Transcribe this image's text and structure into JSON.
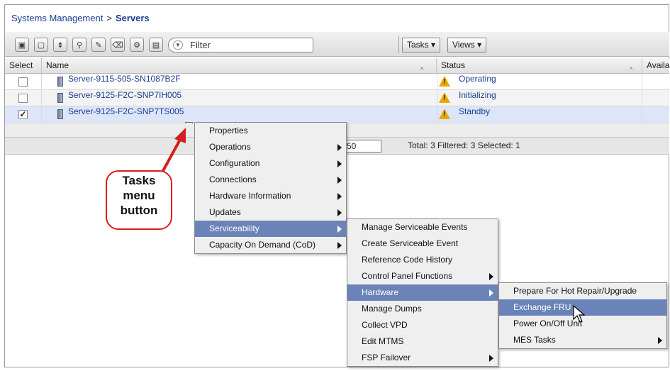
{
  "breadcrumb": {
    "parent": "Systems Management",
    "separator": ">",
    "current": "Servers"
  },
  "toolbar": {
    "filter_placeholder": "Filter",
    "tasks_label": "Tasks ▾",
    "views_label": "Views ▾",
    "icons": [
      "select-all-icon",
      "deselect-all-icon",
      "expand-icon",
      "filter-icon",
      "edit-icon",
      "clear-icon",
      "configure-columns-icon",
      "properties-icon"
    ]
  },
  "table": {
    "columns": {
      "select": "Select",
      "name": "Name",
      "status": "Status",
      "available": "Availal"
    },
    "sort_glyph": "^",
    "rows": [
      {
        "checked": false,
        "check_glyph": "",
        "name": "Server-9115-505-SN1087B2F",
        "status": "Operating"
      },
      {
        "checked": false,
        "check_glyph": "",
        "name": "Server-9125-F2C-SNP7IH005",
        "status": "Initializing"
      },
      {
        "checked": true,
        "check_glyph": "✓",
        "name": "Server-9125-F2C-SNP7TS005",
        "status": "Standby"
      }
    ],
    "warn_glyph": "!",
    "tasks_button_glyph": "»"
  },
  "pager": {
    "page_size": "50",
    "summary": "Total: 3   Filtered: 3   Selected: 1"
  },
  "menu1": [
    {
      "label": "Properties",
      "submenu": false
    },
    {
      "label": "Operations",
      "submenu": true
    },
    {
      "label": "Configuration",
      "submenu": true
    },
    {
      "label": "Connections",
      "submenu": true
    },
    {
      "label": "Hardware Information",
      "submenu": true
    },
    {
      "label": "Updates",
      "submenu": true
    },
    {
      "label": "Serviceability",
      "submenu": true
    },
    {
      "label": "Capacity On Demand (CoD)",
      "submenu": true
    }
  ],
  "menu2": [
    {
      "label": "Manage Serviceable Events",
      "submenu": false
    },
    {
      "label": "Create Serviceable Event",
      "submenu": false
    },
    {
      "label": "Reference Code History",
      "submenu": false
    },
    {
      "label": "Control Panel Functions",
      "submenu": true
    },
    {
      "label": "Hardware",
      "submenu": true
    },
    {
      "label": "Manage Dumps",
      "submenu": false
    },
    {
      "label": "Collect VPD",
      "submenu": false
    },
    {
      "label": "Edit MTMS",
      "submenu": false
    },
    {
      "label": "FSP Failover",
      "submenu": true
    }
  ],
  "menu3": [
    {
      "label": "Prepare For Hot Repair/Upgrade",
      "submenu": false
    },
    {
      "label": "Exchange FRU",
      "submenu": false
    },
    {
      "label": "Power On/Off Unit",
      "submenu": false
    },
    {
      "label": "MES Tasks",
      "submenu": true
    }
  ],
  "callout": {
    "line1": "Tasks",
    "line2": "menu",
    "line3": "button"
  },
  "colors": {
    "link": "#1a3d8f",
    "selected_row": "#dde6f8",
    "menu_highlight": "#6a83b8",
    "callout_border": "#d41f1f",
    "warning": "#e9a700"
  }
}
